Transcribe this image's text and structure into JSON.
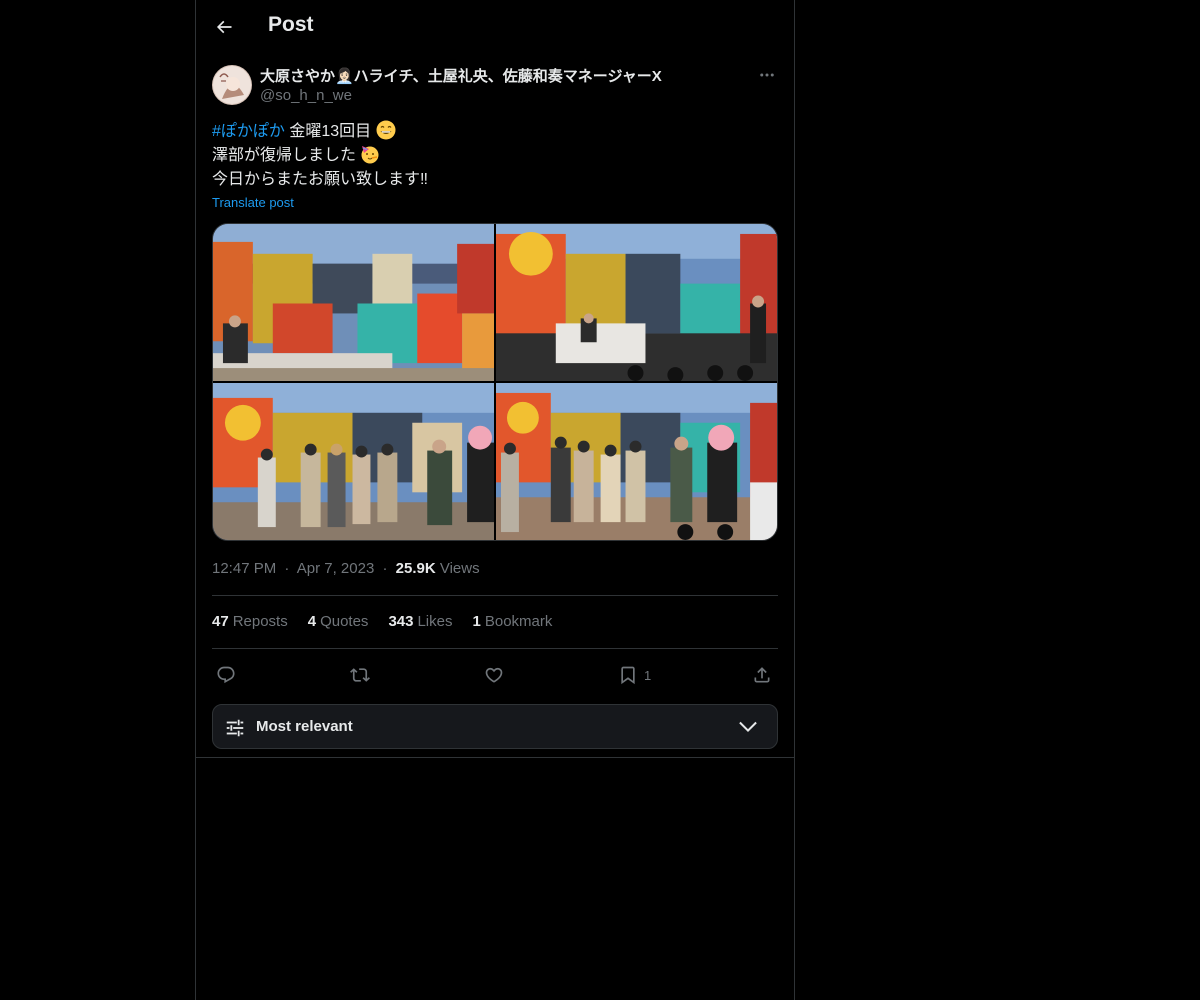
{
  "header": {
    "title": "Post"
  },
  "tweet": {
    "display_name": "大原さやか👩🏻‍💼ハライチ、土屋礼央、佐藤和奏マネージャーX",
    "handle": "@so_h_n_we",
    "text": {
      "line1_hashtag": "#ぽかぽか",
      "line1_rest": " 金曜13回目",
      "line2": "澤部が復帰しました",
      "line3": "今日からまたお願い致します‼︎"
    },
    "translate_label": "Translate post",
    "time": "12:47 PM",
    "date": "Apr 7, 2023",
    "views_count": "25.9K",
    "views_label": "Views",
    "separator": "·"
  },
  "stats": {
    "reposts_count": "47",
    "reposts_label": "Reposts",
    "quotes_count": "4",
    "quotes_label": "Quotes",
    "likes_count": "343",
    "likes_label": "Likes",
    "bookmarks_count": "1",
    "bookmarks_label": "Bookmark"
  },
  "actions": {
    "bookmark_count": "1",
    "icons": [
      "reply-icon",
      "repost-icon",
      "like-icon",
      "bookmark-icon",
      "share-icon"
    ]
  },
  "sort": {
    "label": "Most relevant"
  },
  "colors": {
    "background": "#000000",
    "text": "#e7e9ea",
    "secondary": "#71767b",
    "accent": "#1d9bf0",
    "border": "#2f3336"
  }
}
